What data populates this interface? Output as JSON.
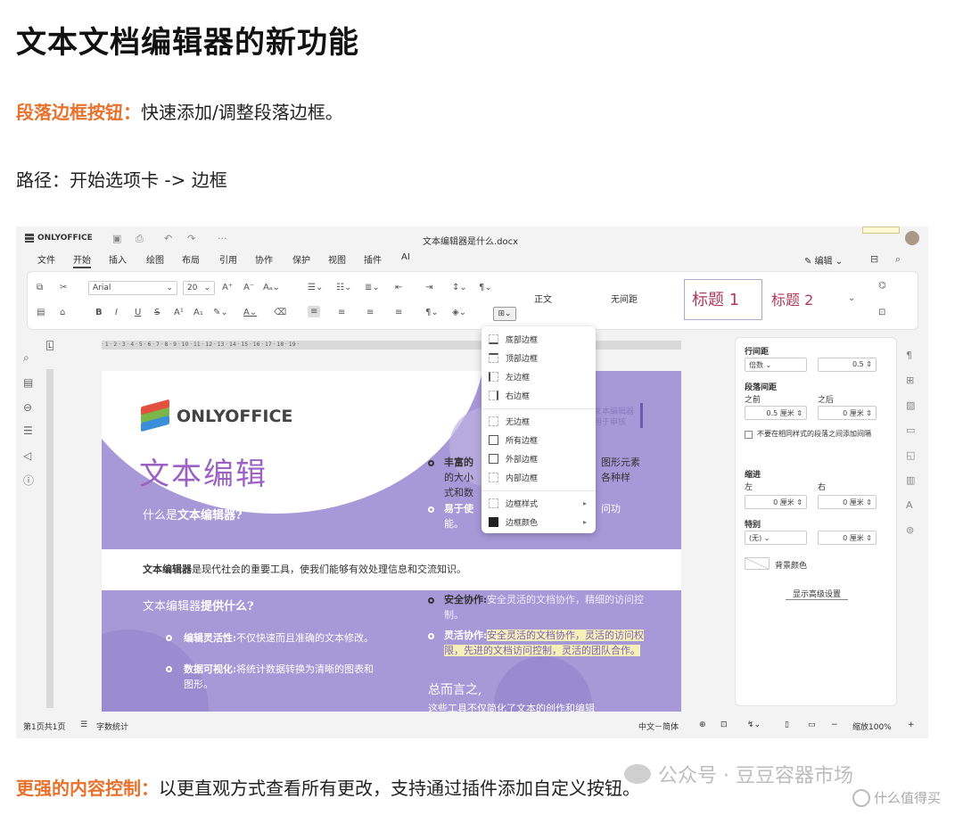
{
  "article": {
    "title": "文本文档编辑器的新功能",
    "p1_lead": "段落边框按钮：",
    "p1_text": "快速添加/调整段落边框。",
    "p2_text": "路径：开始选项卡 -> 边框",
    "p3_lead": "更强的内容控制：",
    "p3_text": "以更直观方式查看所有更改，支持通过插件添加自定义按钮。"
  },
  "app": {
    "brand": "ONLYOFFICE",
    "doc_title": "文本编辑器是什么.docx",
    "more": "···",
    "menu": [
      "文件",
      "开始",
      "插入",
      "绘图",
      "布局",
      "引用",
      "协作",
      "保护",
      "视图",
      "插件",
      "AI"
    ],
    "edit_mode": "编辑",
    "font_name": "Arial",
    "font_size": "20",
    "styles": [
      "正文",
      "无间距",
      "标题 1",
      "标题 2"
    ],
    "ruler_text": "· 1 · 2 · 3 · 4 · 5 · 6 · 7 · 8 · 9 · 10 · 11 · 12 · 13 · 14 · 15 · 16 · 17 · 18 · 19 ·",
    "icons": {
      "brand": "onlyoffice-logo-icon",
      "save": "save-icon",
      "print": "print-icon",
      "undo": "undo-icon",
      "redo": "redo-icon",
      "borders": "paragraph-borders-icon"
    }
  },
  "page": {
    "logo_text": "ONLYOFFICE",
    "cover_title": "文本编辑",
    "q1_prefix": "什么是",
    "q1_bold": "文本编辑器?",
    "intro_bold": "文本编辑器",
    "intro_text": "是现代社会的重要工具，使我们能够有效处理信息和交流知识。",
    "q2_prefix": "文本编辑器",
    "q2_bold": "提供什么?",
    "l1_bold": "编辑灵活性:",
    "l1_text": "不仅快速而且准确的文本修改。",
    "l2_bold": "数据可视化:",
    "l2_text": "将统计数据转换为清晰的图表和图形。",
    "r1_bold": "丰富的",
    "r1_text": "的大小",
    "r1_cont": "式和数",
    "r1_tail": "图形元素",
    "r1_tail2": "各种样",
    "r2_bold": "易于使",
    "r2_text": "能。",
    "r2_tail": "问功",
    "r3_bold": "安全协作:",
    "r3_text": "安全灵活的文档协作，精细的访问控制。",
    "r4_bold": "灵活协作:",
    "r4_text": "安全灵活的文档协作，灵活的访问权限，先进的文档访问控制，灵活的团队合作。",
    "summary": "总而言之,",
    "summary_text": "这些工具不仅简化了文本的创作和编辑",
    "side_note": "文本编辑器用于审核"
  },
  "borders_menu": {
    "items": [
      "底部边框",
      "顶部边框",
      "左边框",
      "右边框",
      "无边框",
      "所有边框",
      "外部边框",
      "内部边框",
      "边框样式",
      "边框颜色"
    ]
  },
  "right_panel": {
    "line_spacing": "行间距",
    "line_type": "倍数",
    "line_value": "0.5",
    "para_spacing": "段落间距",
    "before": "之前",
    "after": "之后",
    "before_val": "0.5 厘米",
    "after_val": "0 厘米",
    "no_space": "不要在相同样式的段落之间添加间隔",
    "indent": "缩进",
    "left": "左",
    "right": "右",
    "left_val": "0 厘米",
    "right_val": "0 厘米",
    "special": "特别",
    "special_type": "(无)",
    "special_val": "0 厘米",
    "bg_color": "背景颜色",
    "advanced": "显示高级设置"
  },
  "statusbar": {
    "page": "第1页共1页",
    "word_count": "字数统计",
    "lang": "中文－简体",
    "zoom": "缩放100%"
  },
  "watermark": {
    "text": "公众号 · 豆豆容器市场",
    "zhihu": "什么值得买"
  },
  "colors": {
    "accent_orange": "#e8712b",
    "page_purple": "#a799d8",
    "heading_rose": "#b03a5b"
  }
}
